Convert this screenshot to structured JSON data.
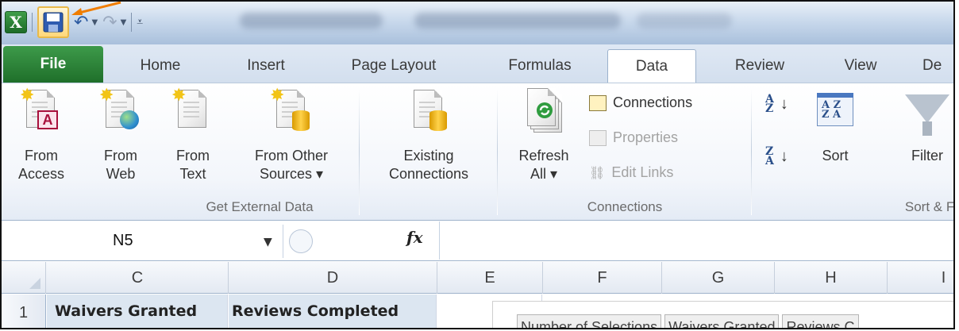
{
  "quick_access": {
    "app_logo_letter": "X",
    "save_icon": "floppy-disk-icon",
    "undo_icon": "undo-icon",
    "redo_icon": "redo-icon",
    "customize_icon": "customize-qat-icon"
  },
  "ribbon_tabs": [
    {
      "label": "File"
    },
    {
      "label": "Home"
    },
    {
      "label": "Insert"
    },
    {
      "label": "Page Layout"
    },
    {
      "label": "Formulas"
    },
    {
      "label": "Data"
    },
    {
      "label": "Review"
    },
    {
      "label": "View"
    },
    {
      "label": "De"
    }
  ],
  "active_tab": "Data",
  "groups": {
    "external": {
      "label": "Get External Data",
      "from_access": {
        "line1": "From",
        "line2": "Access"
      },
      "from_web": {
        "line1": "From",
        "line2": "Web"
      },
      "from_text": {
        "line1": "From",
        "line2": "Text"
      },
      "from_other": {
        "line1": "From Other",
        "line2": "Sources ▾"
      },
      "existing": {
        "line1": "Existing",
        "line2": "Connections"
      }
    },
    "connections": {
      "label": "Connections",
      "refresh": {
        "line1": "Refresh",
        "line2": "All ▾"
      },
      "connections_label": "Connections",
      "properties_label": "Properties",
      "edit_links_label": "Edit Links"
    },
    "sort_filter": {
      "label": "Sort & Fi",
      "sort_az_label": "A\nZ",
      "sort_label": "Sort",
      "filter_label": "Filter"
    }
  },
  "formula_bar": {
    "name_box": "N5",
    "fx_label": "fx",
    "formula": ""
  },
  "columns": [
    "C",
    "D",
    "E",
    "F",
    "G",
    "H",
    "I"
  ],
  "rows": [
    {
      "number": "1",
      "C": "Waivers Granted",
      "D": "Reviews Completed"
    }
  ],
  "chart_tabs": [
    "Number of Selections",
    "Waivers Granted",
    "Reviews C"
  ],
  "colors": {
    "file_tab": "#2a7f35",
    "selected_header_fill": "#dce6f1",
    "annotation_arrow": "#f07d00"
  }
}
